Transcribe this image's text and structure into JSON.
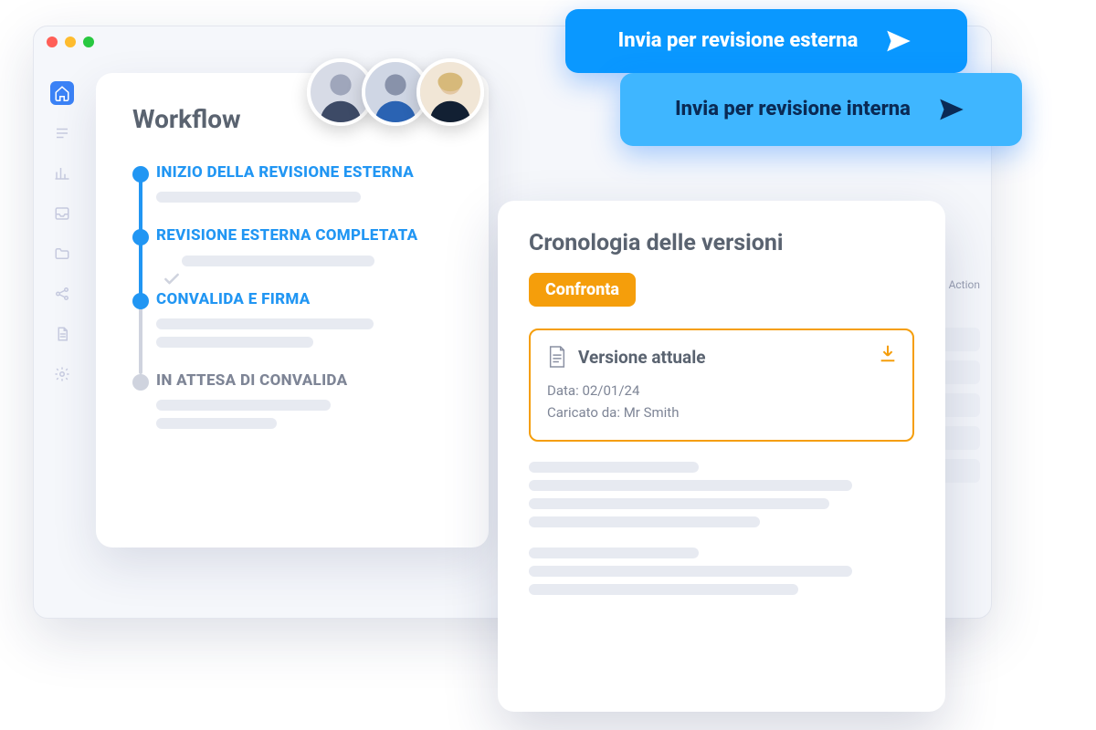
{
  "colors": {
    "blue": "#2196f3",
    "lightblue": "#3fb6ff",
    "orange": "#f59e0b",
    "grey": "#7e8596"
  },
  "workflow": {
    "title": "Workflow",
    "steps": [
      {
        "label": "INIZIO DELLA REVISIONE ESTERNA",
        "state": "done"
      },
      {
        "label": "REVISIONE ESTERNA COMPLETATA",
        "state": "done",
        "check": true
      },
      {
        "label": "CONVALIDA E FIRMA",
        "state": "done"
      },
      {
        "label": "IN ATTESA DI CONVALIDA",
        "state": "pending"
      }
    ]
  },
  "actions": {
    "external": "Invia per revisione esterna",
    "internal": "Invia per revisione interna"
  },
  "versions": {
    "title": "Cronologia delle versioni",
    "compare": "Confronta",
    "current": {
      "heading": "Versione attuale",
      "date_label": "Data",
      "date": "02/01/24",
      "uploader_label": "Caricato da",
      "uploader": "Mr Smith"
    }
  },
  "chips_header": "Action"
}
